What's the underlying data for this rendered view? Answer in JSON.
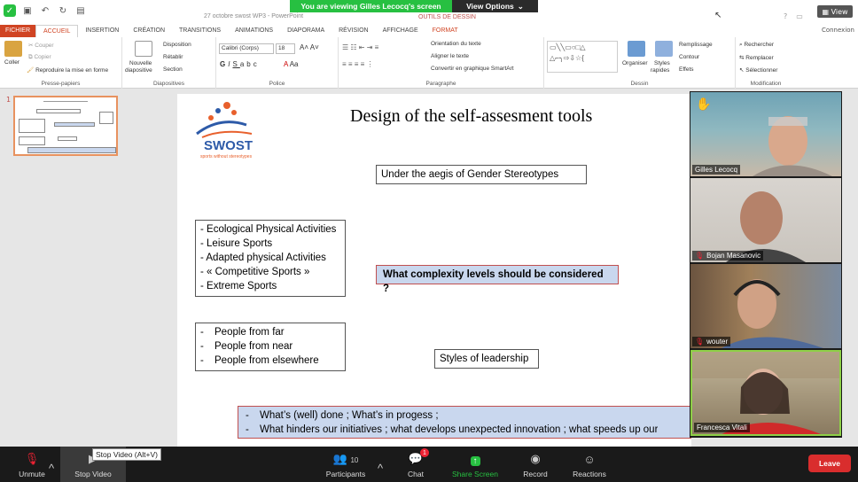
{
  "window": {
    "title": "27 octobre swost WP3 - PowerPoint",
    "tools_label": "OUTILS DE DESSIN",
    "view_btn": "View"
  },
  "zoom_banner": {
    "viewing": "You are viewing Gilles Lecocq's screen",
    "view_options": "View Options"
  },
  "ribbon": {
    "tabs": [
      "FICHIER",
      "ACCUEIL",
      "INSERTION",
      "CRÉATION",
      "TRANSITIONS",
      "ANIMATIONS",
      "DIAPORAMA",
      "RÉVISION",
      "AFFICHAGE",
      "FORMAT"
    ],
    "account": "Connexion",
    "clipboard": {
      "paste": "Coller",
      "cut": "Couper",
      "copy": "Copier",
      "format_painter": "Reproduire la mise en forme",
      "label": "Presse-papiers"
    },
    "slides": {
      "new_slide": "Nouvelle",
      "new_slide2": "diapositive",
      "layout": "Disposition",
      "reset": "Rétablir",
      "section": "Section",
      "label": "Diapositives"
    },
    "font": {
      "name": "Calibri (Corps)",
      "size": "18",
      "label": "Police"
    },
    "paragraph": {
      "direction": "Orientation du texte",
      "align": "Aligner le texte",
      "smartart": "Convertir en graphique SmartArt",
      "label": "Paragraphe"
    },
    "drawing": {
      "arrange": "Organiser",
      "styles": "Styles",
      "styles2": "rapides",
      "fill": "Remplissage",
      "outline": "Contour",
      "effects": "Effets",
      "label": "Dessin"
    },
    "editing": {
      "find": "Rechercher",
      "replace": "Remplacer",
      "select": "Sélectionner",
      "label": "Modification"
    }
  },
  "thumbnail": {
    "number": "1"
  },
  "slide": {
    "logo_text": "SWOST",
    "logo_sub": "sports without stereotypes",
    "title": "Design of the self-assesment tools",
    "aegis": "Under the aegis of Gender Stereotypes",
    "activities": [
      "- Ecological Physical Activities",
      "- Leisure Sports",
      "- Adapted physical Activities",
      "- « Competitive Sports »",
      "- Extreme Sports"
    ],
    "complexity": "What complexity levels should be considered ?",
    "people": [
      "People from far",
      "People from near",
      "People from elsewhere"
    ],
    "people_dash": "-",
    "styles": "Styles of leadership",
    "bottom": [
      "What’s (well) done ; What’s in progess ;",
      "What hinders our initiatives ; what develops unexpected innovation ; what speeds up our"
    ],
    "bottom_dash": "-"
  },
  "participants_video": [
    {
      "name": "Gilles Lecocq",
      "muted": false,
      "hand": true
    },
    {
      "name": "Bojan Masanovic",
      "muted": true
    },
    {
      "name": "wouter",
      "muted": true
    },
    {
      "name": "Francesca Vitali",
      "muted": false
    }
  ],
  "toolbar": {
    "unmute": "Unmute",
    "stop_video": "Stop Video",
    "stop_video_tip": "Stop Video (Alt+V)",
    "participants": "Participants",
    "participants_count": "10",
    "chat": "Chat",
    "chat_badge": "1",
    "share": "Share Screen",
    "record": "Record",
    "reactions": "Reactions",
    "leave": "Leave"
  },
  "colors": {
    "zoom_green": "#27c041",
    "ppt_orange": "#d04423",
    "leave_red": "#d92d2d",
    "highlight_box": "#c9d7ee"
  }
}
